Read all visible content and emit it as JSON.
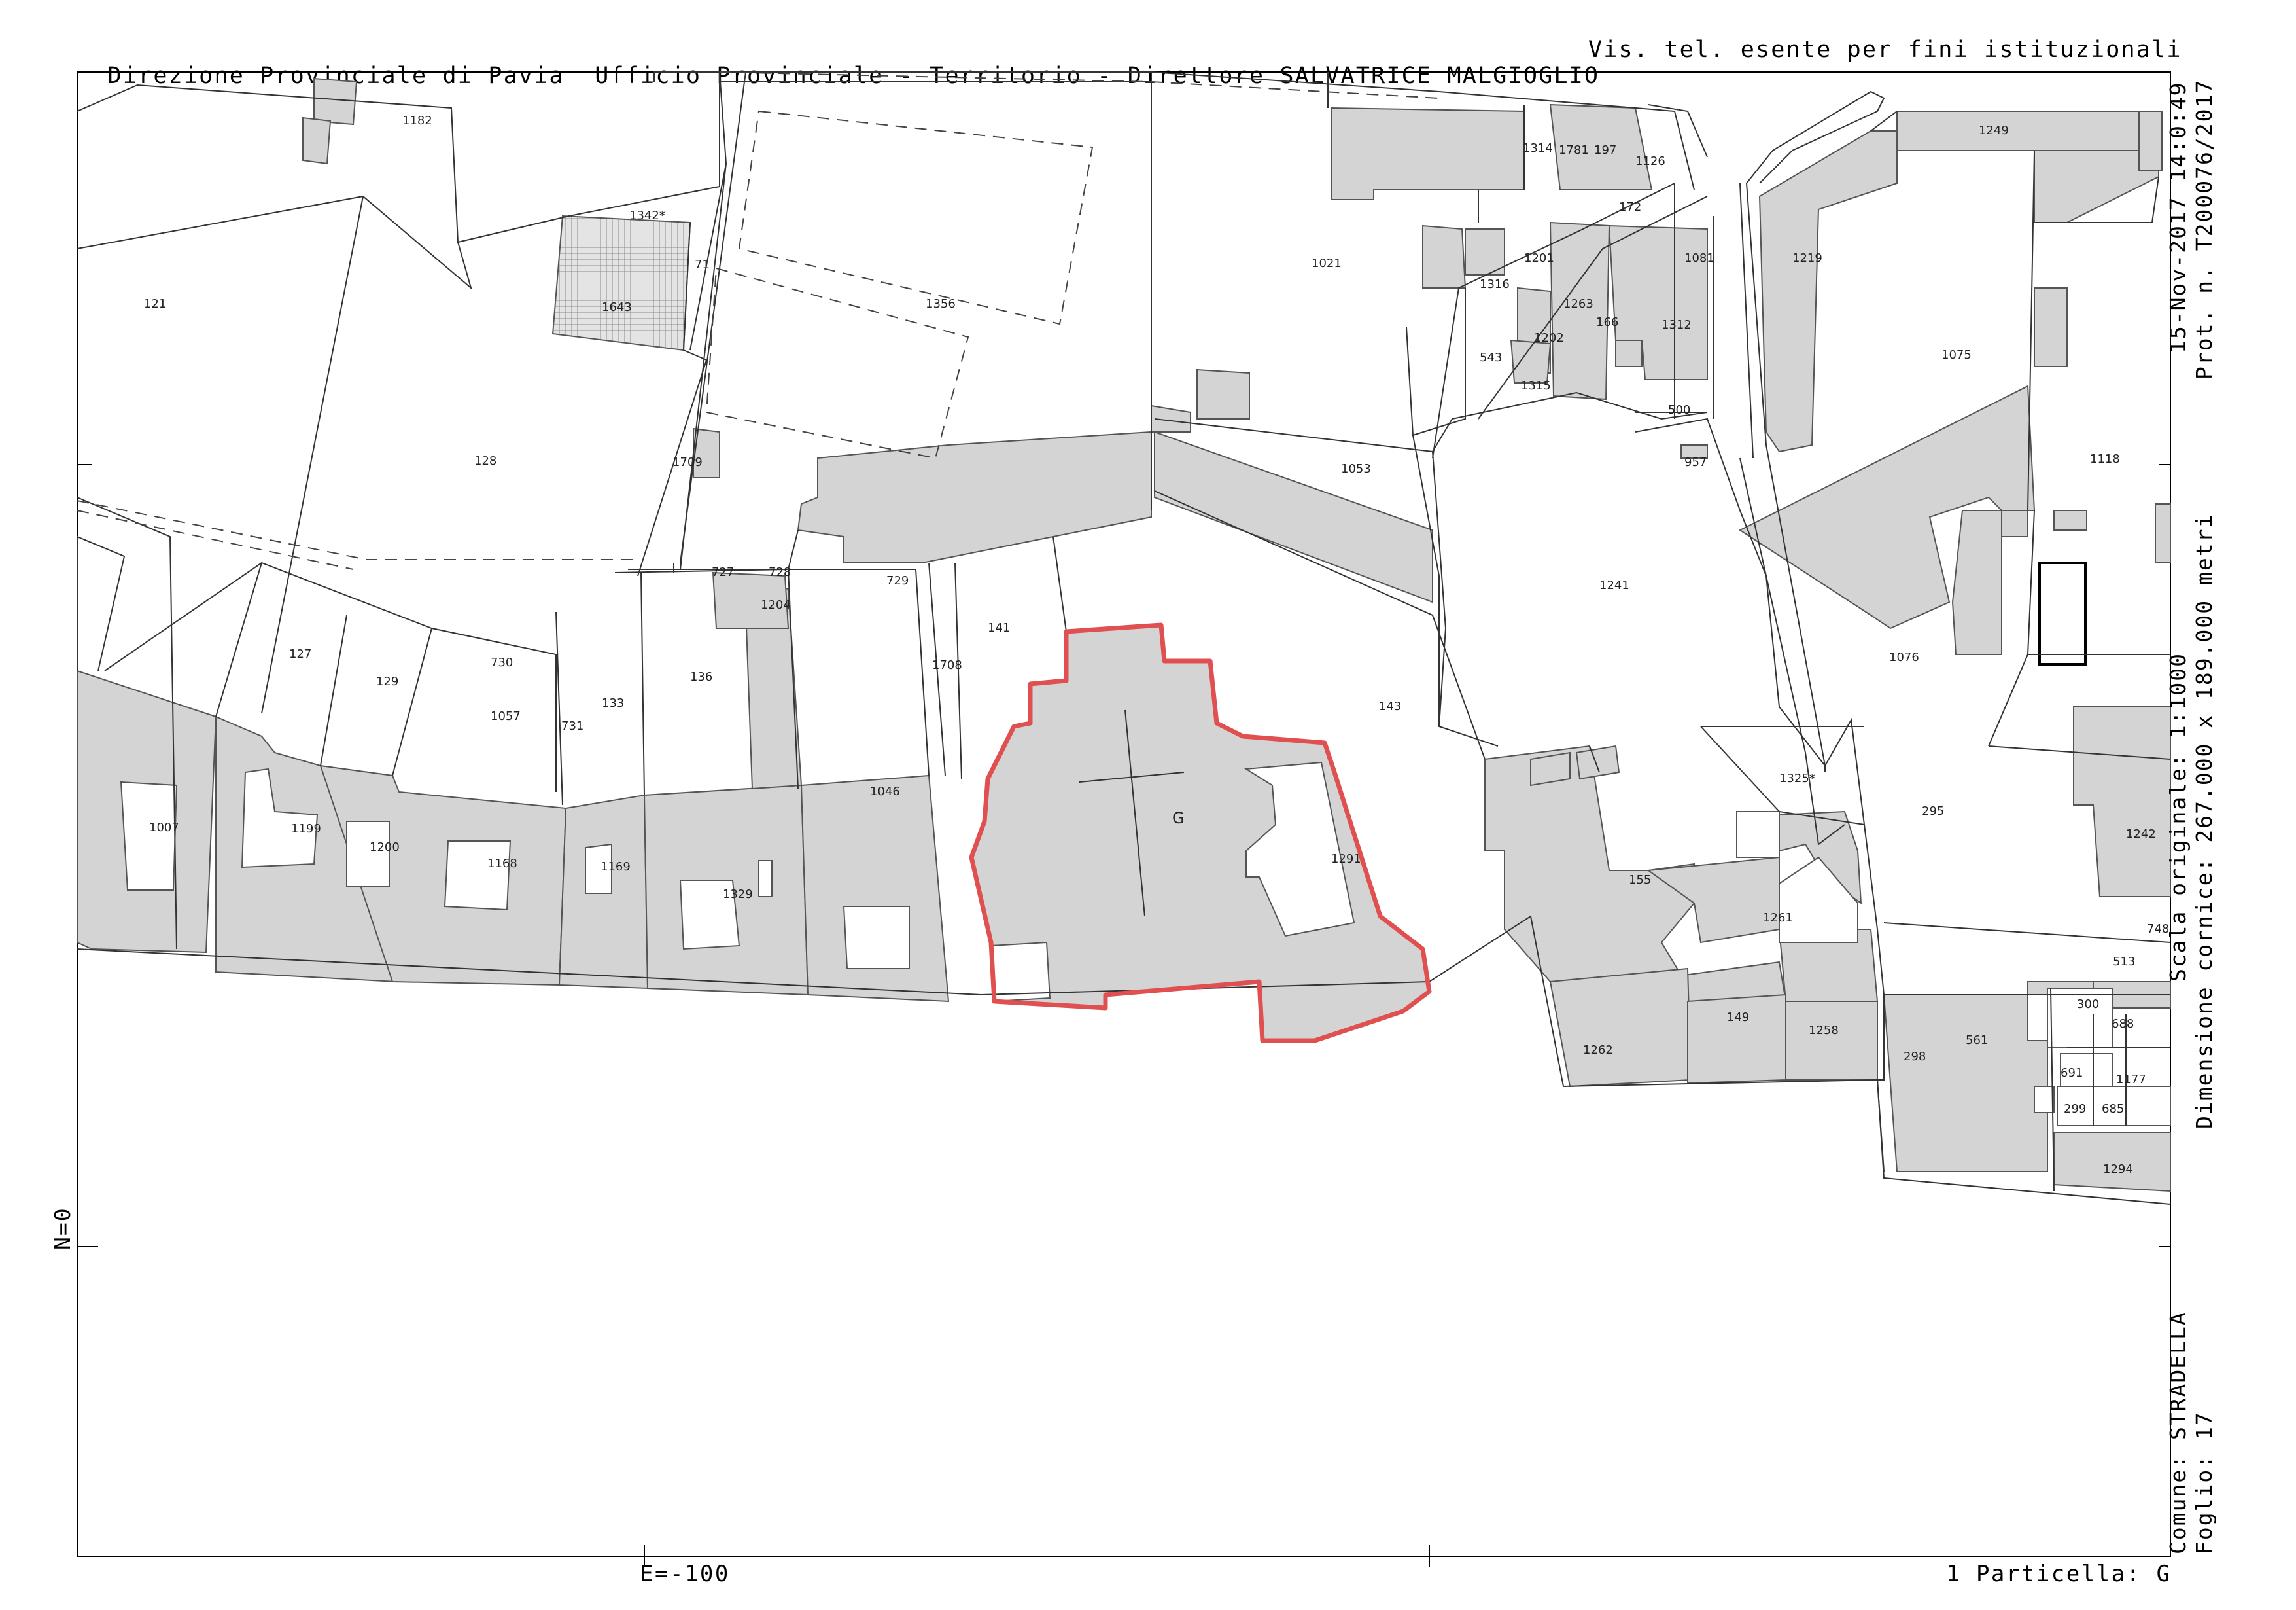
{
  "header": {
    "office": "Direzione Provinciale di Pavia  Ufficio Provinciale - Territorio - Direttore SALVATRICE MALGIOGLIO",
    "note": "Vis. tel. esente per fini istituzionali"
  },
  "side_right": {
    "date": "15-Nov-2017 14:0:49",
    "protocol": "Prot. n. T200076/2017",
    "scale": "Scala originale: 1:1000",
    "frame": "Dimensione cornice: 267.000 x 189.000 metri",
    "comune": "Comune: STRADELLA",
    "foglio": "Foglio: 17"
  },
  "coords": {
    "north": "N=0",
    "east": "E=-100"
  },
  "footer": {
    "particella": "1 Particella: G"
  },
  "highlight_color": "#e05050",
  "building_fill": "#d4d4d4",
  "parcels": {
    "p1182": "1182",
    "p121": "121",
    "p1342": "1342*",
    "p1643": "1643",
    "p71": "71",
    "p1356": "1356",
    "p128": "128",
    "p1709": "1709",
    "p727": "727",
    "p728": "728",
    "p729": "729",
    "p1204": "1204",
    "p127": "127",
    "p129": "129",
    "p730": "730",
    "p133": "133",
    "p136": "136",
    "p731": "731",
    "p1057": "1057",
    "p141": "141",
    "p1708": "1708",
    "p1046": "1046",
    "p1007": "1007",
    "p1199": "1199",
    "p1200": "1200",
    "p1168": "1168",
    "p1169": "1169",
    "p1329": "1329",
    "pG": "G",
    "p143": "143",
    "p1291": "1291",
    "p1053": "1053",
    "p1021": "1021",
    "p1314": "1314",
    "p1781": "1781",
    "p197": "197",
    "p1126": "1126",
    "p172": "172",
    "p1316": "1316",
    "p1201": "1201",
    "p1081": "1081",
    "p1263": "1263",
    "p166": "166",
    "p1312": "1312",
    "p543": "543",
    "p1202": "1202",
    "p1315": "1315",
    "p500": "500",
    "p957": "957",
    "p1241": "1241",
    "p1249": "1249",
    "p1219": "1219",
    "p1075": "1075",
    "p1118": "1118",
    "p1076": "1076",
    "p295": "295",
    "p1242": "1242",
    "p1325": "1325*",
    "p155": "155",
    "p1261": "1261",
    "p748": "748",
    "p513": "513",
    "p300": "300",
    "p688": "688",
    "p561": "561",
    "p298": "298",
    "p691": "691",
    "p1177": "1177",
    "p299": "299",
    "p685": "685",
    "p1262": "1262",
    "p149": "149",
    "p1258": "1258",
    "p1294": "1294"
  }
}
